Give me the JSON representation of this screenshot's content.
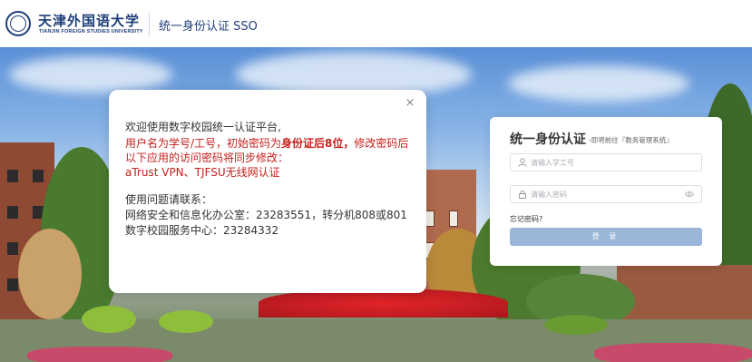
{
  "header": {
    "logo_cn": "天津外国语大学",
    "logo_en": "TIANJIN FOREIGN STUDIES UNIVERSITY",
    "title": "统一身份认证 SSO"
  },
  "notice": {
    "line1": "欢迎使用数字校园统一认证平台,",
    "line2_a": "用户名为学号/工号，初始密码为",
    "line2_b": "身份证后8位，",
    "line2_c": "修改密码后",
    "line3": "以下应用的访问密码将同步修改：",
    "line4": "aTrust VPN、TJFSU无线网认证",
    "line5": "使用问题请联系：",
    "line6": "网络安全和信息化办公室：23283551，转分机808或801",
    "line7": "数字校园服务中心：23284332",
    "close_glyph": "×"
  },
  "login": {
    "title": "统一身份认证",
    "subtitle": "-即将前往『教务管理系统』",
    "username_placeholder": "请输入学工号",
    "password_placeholder": "请输入密码",
    "forgot": "忘记密码?",
    "submit": "登 录"
  },
  "colors": {
    "brand": "#1f3f7a",
    "notice_red": "#c5201c",
    "button": "#9ab6d8"
  },
  "icons": {
    "logo": "university-seal-icon",
    "close": "close-icon",
    "user": "user-icon",
    "lock": "lock-icon",
    "eye": "eye-icon"
  }
}
